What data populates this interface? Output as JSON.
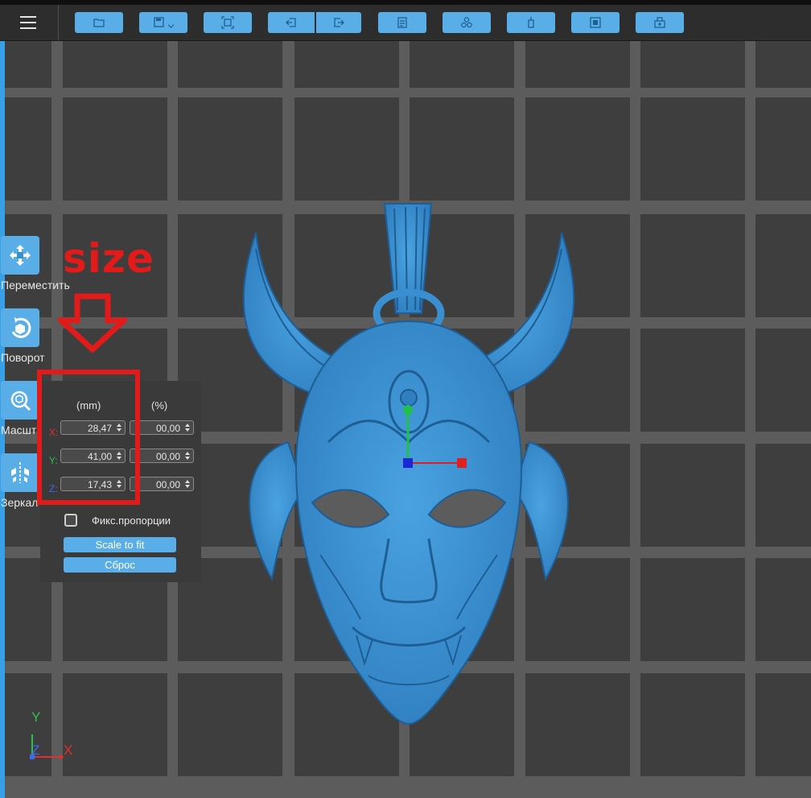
{
  "toolbar": {
    "menu_icon": "hamburger-icon",
    "buttons": [
      {
        "icon": "open-file-icon"
      },
      {
        "icon": "save-icon",
        "has_dropdown": true
      },
      {
        "icon": "fit-view-icon"
      },
      {
        "icon": "import-icon"
      },
      {
        "icon": "export-icon"
      },
      {
        "icon": "document-icon"
      },
      {
        "icon": "arrange-icon"
      },
      {
        "icon": "support-icon"
      },
      {
        "icon": "slice-icon"
      },
      {
        "icon": "print-icon"
      }
    ]
  },
  "side_tools": [
    {
      "icon": "move-icon",
      "label": "Переместить"
    },
    {
      "icon": "rotate-icon",
      "label": "Поворот"
    },
    {
      "icon": "scale-icon",
      "label": "Масшт"
    },
    {
      "icon": "mirror-icon",
      "label": "Зеркал"
    }
  ],
  "scale_panel": {
    "col_mm": "(mm)",
    "col_pct": "(%)",
    "rows": [
      {
        "axis": "X:",
        "mm": "28,47",
        "pct": "00,00"
      },
      {
        "axis": "Y:",
        "mm": "41,00",
        "pct": "00,00"
      },
      {
        "axis": "Z:",
        "mm": "17,43",
        "pct": "00,00"
      }
    ],
    "lock_label": "Фикс.пропорции",
    "lock_checked": false,
    "scale_to_fit": "Scale to fit",
    "reset": "Сброс"
  },
  "annotation": {
    "text": "size"
  },
  "axis_indicator": {
    "y": "Y",
    "z": "Z",
    "x": "X"
  },
  "colors": {
    "accent": "#5aaee8",
    "model": "#3d8fcf",
    "annotation": "#e11a1a",
    "grid_dark": "#3e3e3e",
    "grid_light": "#5c5c5c"
  }
}
